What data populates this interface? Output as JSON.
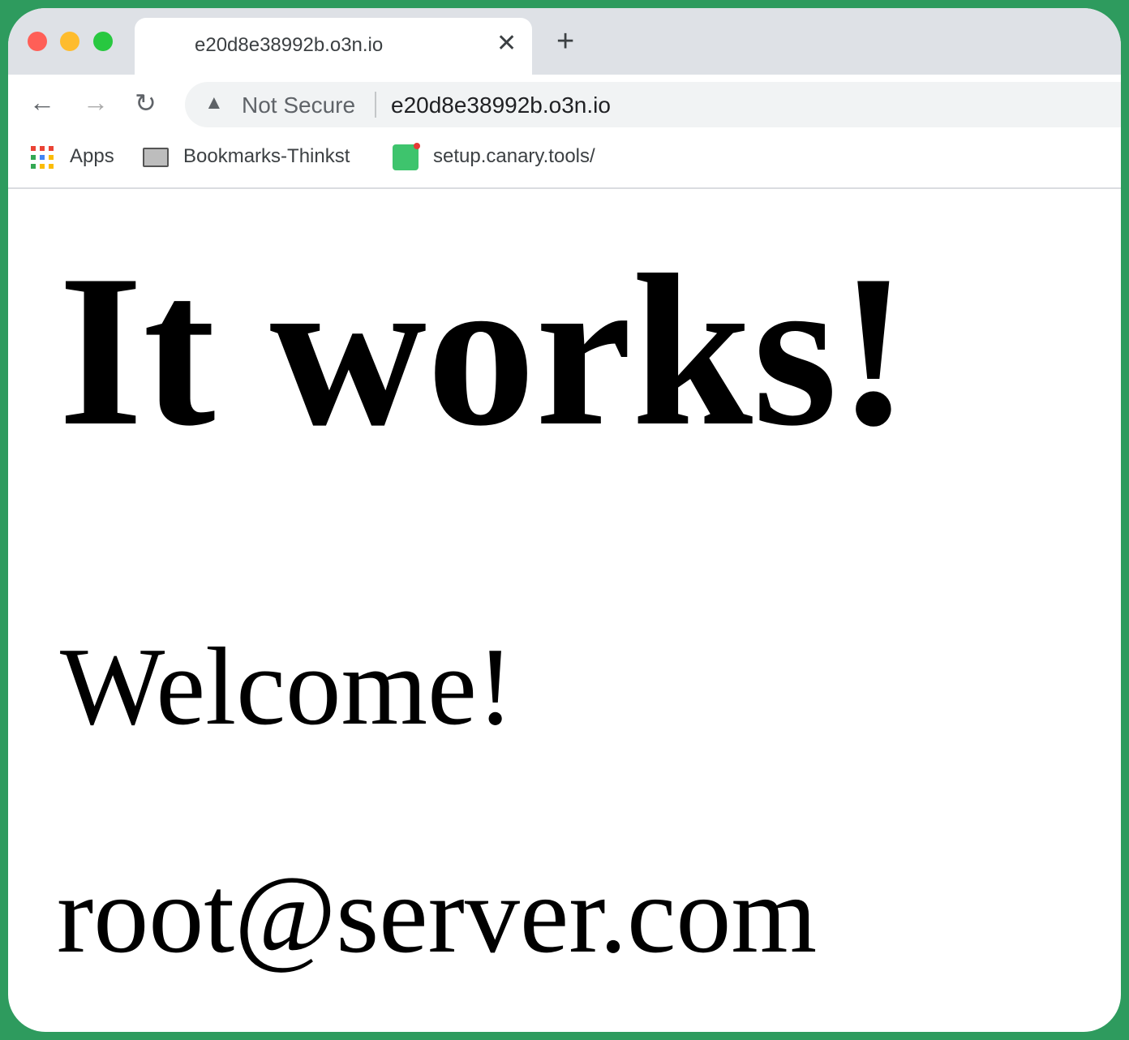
{
  "browser": {
    "tab": {
      "title": "e20d8e38992b.o3n.io",
      "close": "✕"
    },
    "new_tab": "+",
    "nav": {
      "back": "←",
      "forward": "→",
      "reload": "↻"
    },
    "omnibox": {
      "security_label": "Not Secure",
      "url": "e20d8e38992b.o3n.io",
      "warning_icon": "▲"
    },
    "bookmarks": [
      {
        "label": "Apps",
        "icon": "apps-grid-icon"
      },
      {
        "label": "Bookmarks-Thinkst",
        "icon": "folder-icon"
      },
      {
        "label": "setup.canary.tools/",
        "icon": "canary-icon"
      }
    ],
    "traffic_lights": {
      "close": "#ff5f57",
      "minimize": "#febc2e",
      "zoom": "#28c840"
    },
    "frame_color": "#2e9b5e"
  },
  "page": {
    "heading": "It works!",
    "welcome": "Welcome!",
    "email": "root@server.com"
  }
}
